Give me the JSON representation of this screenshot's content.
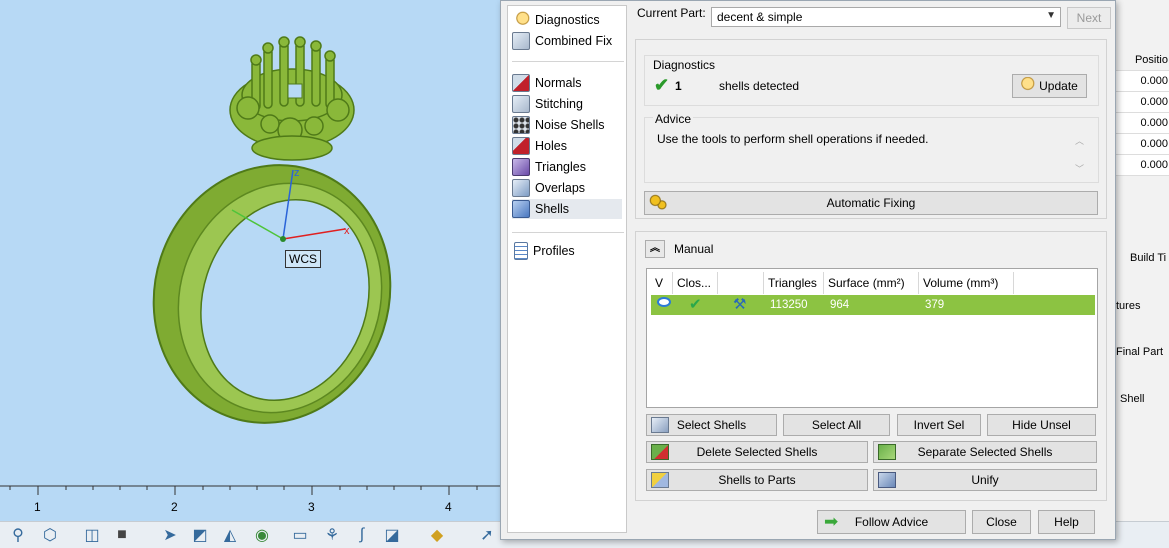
{
  "viewport": {
    "wcs_label": "WCS",
    "axes": {
      "x": "x",
      "z": "z"
    },
    "ruler": [
      "1",
      "2",
      "3",
      "4"
    ]
  },
  "nav": {
    "items": [
      {
        "label": "Diagnostics",
        "icon": "magnifier-icon"
      },
      {
        "label": "Combined Fix",
        "icon": "cube-icon"
      },
      {
        "label": "Normals",
        "icon": "cube-red-icon"
      },
      {
        "label": "Stitching",
        "icon": "cube-icon"
      },
      {
        "label": "Noise Shells",
        "icon": "dice-icon"
      },
      {
        "label": "Holes",
        "icon": "cube-red-icon"
      },
      {
        "label": "Triangles",
        "icon": "cube-purple-icon"
      },
      {
        "label": "Overlaps",
        "icon": "cube-icon"
      },
      {
        "label": "Shells",
        "icon": "cube-blue-icon"
      },
      {
        "label": "Profiles",
        "icon": "document-icon"
      }
    ],
    "active": "Shells"
  },
  "header": {
    "current_part_label": "Current Part:",
    "current_part_value": "decent & simple",
    "next_label": "Next"
  },
  "diagnostics": {
    "title": "Diagnostics",
    "count": "1",
    "status_text": "shells detected",
    "update_label": "Update"
  },
  "advice": {
    "title": "Advice",
    "text": "Use the tools to perform shell operations if needed."
  },
  "automatic_fixing_label": "Automatic Fixing",
  "manual": {
    "title": "Manual",
    "columns": [
      "V",
      "Clos...",
      "",
      "Triangles",
      "Surface (mm²)",
      "Volume (mm³)"
    ],
    "rows": [
      {
        "triangles": "113250",
        "surface": "964",
        "volume": "379"
      }
    ],
    "buttons": {
      "select_shells": "Select Shells",
      "select_all": "Select All",
      "invert_sel": "Invert Sel",
      "hide_unsel": "Hide Unsel",
      "delete_selected": "Delete Selected Shells",
      "separate_selected": "Separate Selected Shells",
      "shells_to_parts": "Shells to Parts",
      "unify": "Unify"
    }
  },
  "footer": {
    "follow_advice": "Follow Advice",
    "close": "Close",
    "help": "Help"
  },
  "background_panel": {
    "header": "Positio",
    "values": [
      "0.000",
      "0.000",
      "0.000",
      "0.000",
      "0.000"
    ],
    "labels": [
      "Build Ti",
      "tures",
      "Final Part",
      "Shell"
    ]
  },
  "colors": {
    "viewport_bg": "#b7d9f5",
    "ring_green": "#8ab83a",
    "row_selected": "#8cc342",
    "axis_x": "#e02020",
    "axis_z": "#2a64d8",
    "axis_y": "#4fc43a"
  }
}
